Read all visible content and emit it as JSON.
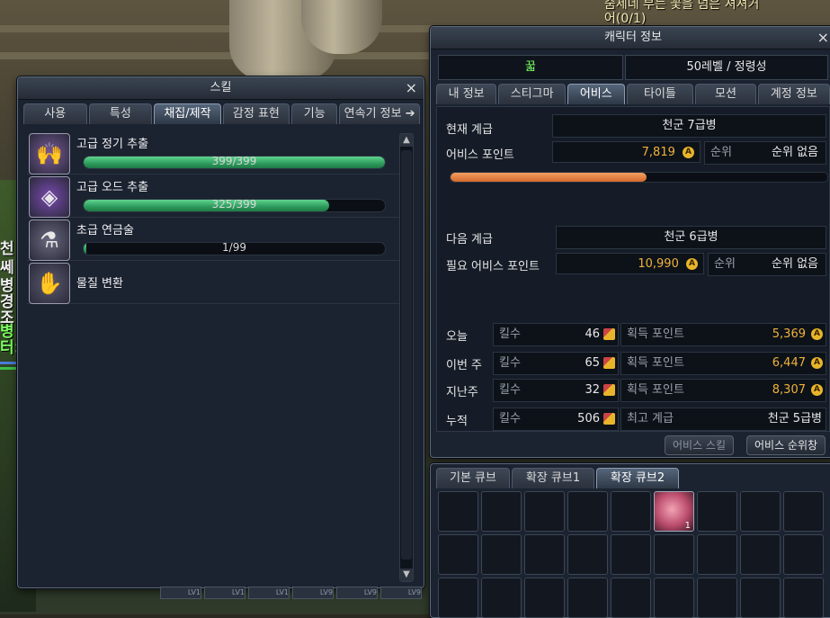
{
  "background": {
    "quest_line1": "숨세네 부는 꽃을 덤은 셔셔거",
    "quest_line2": "어(0/1)",
    "side_texts": [
      "천",
      "쎄",
      "병",
      "경",
      "조",
      "병",
      "터>"
    ]
  },
  "skill_window": {
    "title": "스킬",
    "close": "×",
    "tabs": [
      "사용",
      "특성",
      "채집/제작",
      "감정 표현",
      "기능",
      "연속기 정보"
    ],
    "active_tab": 2,
    "more_arrow": "➔",
    "skills": [
      {
        "name": "고급 정기 추출",
        "value": 399,
        "max": 399,
        "progress_text": "399/399",
        "icon": "hands-essence-icon",
        "glyph": "🙌",
        "icon_color": "#7a5a9a"
      },
      {
        "name": "고급 오드 추출",
        "value": 325,
        "max": 399,
        "progress_text": "325/399",
        "icon": "aether-crystal-icon",
        "glyph": "◈",
        "icon_color": "#7a4ab0"
      },
      {
        "name": "초급 연금술",
        "value": 1,
        "max": 99,
        "progress_text": "1/99",
        "icon": "alchemy-flask-icon",
        "glyph": "⚗",
        "icon_color": "#6a6a80"
      },
      {
        "name": "물질 변환",
        "icon": "material-transform-icon",
        "glyph": "✋",
        "icon_color": "#5a5a70"
      }
    ]
  },
  "character_window": {
    "title": "캐릭터 정보",
    "close": "×",
    "class_name": "꿃",
    "level_info": "50레벨 / 정령성",
    "tabs": [
      "내 정보",
      "스티그마",
      "어비스",
      "타이틀",
      "모션",
      "계정 정보"
    ],
    "active_tab": 2,
    "current_rank_label": "현재 계급",
    "current_rank": "천군 7급병",
    "abyss_points_label": "어비스 포인트",
    "abyss_points": "7,819",
    "abyss_progress": 0.52,
    "rank_label": "순위",
    "rank_value": "순위 없음",
    "next_rank_label": "다음 계급",
    "next_rank": "천군 6급병",
    "required_points_label": "필요 어비스 포인트",
    "required_points": "10,990",
    "rank_label2": "순위",
    "rank_value2": "순위 없음",
    "kill_label": "킬수",
    "earned_label": "획득 포인트",
    "stats": [
      {
        "period": "오늘",
        "kills": "46",
        "points": "5,369"
      },
      {
        "period": "이번 주",
        "kills": "65",
        "points": "6,447"
      },
      {
        "period": "지난주",
        "kills": "32",
        "points": "8,307"
      }
    ],
    "total": {
      "period": "누적",
      "kills": "506",
      "best_label": "최고 계급",
      "best_rank": "천군 5급병"
    },
    "coin_symbol": "A",
    "buttons": {
      "abyss_skill": "어비스 스킬",
      "abyss_ranking": "어비스 순위창"
    }
  },
  "cube_window": {
    "tabs": [
      "기본 큐브",
      "확장 큐브1",
      "확장 큐브2"
    ],
    "active_tab": 2,
    "item_slot_index": 5,
    "item_count": "1",
    "slot_count": 27
  },
  "quickbar": {
    "labels": [
      "LV1",
      "LV1",
      "LV1",
      "LV9",
      "LV9",
      "LV9"
    ]
  }
}
